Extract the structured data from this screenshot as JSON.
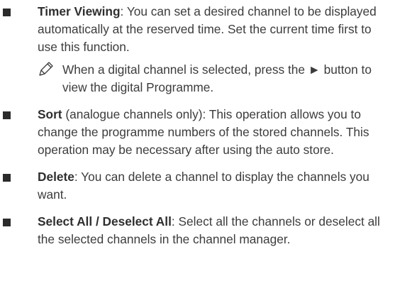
{
  "items": [
    {
      "term": "Timer Viewing",
      "text": ": You can set a desired channel to be displayed automatically at the reserved time. Set the current time first to use this function."
    },
    {
      "term": "Sort",
      "text": " (analogue channels only): This operation allows you to change the programme numbers of the stored channels. This operation may be necessary after using the auto store."
    },
    {
      "term": "Delete",
      "text": ": You can delete a channel to display the channels you want."
    },
    {
      "term": "Select All / Deselect All",
      "text": ": Select all the channels or deselect all the selected channels in the channel manager."
    }
  ],
  "note": {
    "icon": "pencil-note-icon",
    "text": "When a digital channel is selected, press the ► button to view the digital Programme."
  }
}
